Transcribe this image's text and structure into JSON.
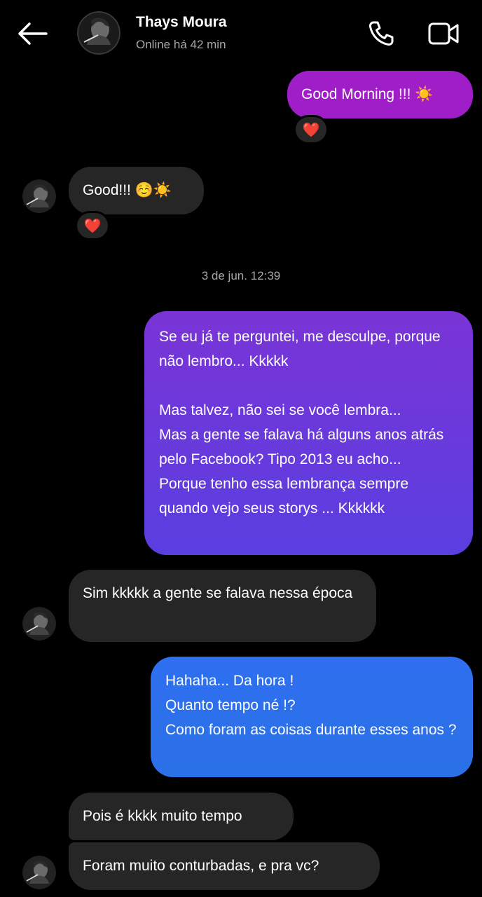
{
  "header": {
    "contact_name": "Thays Moura",
    "status": "Online há 42 min",
    "back_icon": "arrow-left-icon",
    "call_icon": "phone-icon",
    "video_icon": "video-camera-icon"
  },
  "timestamp": "3 de jun. 12:39",
  "messages": [
    {
      "side": "sent",
      "text": "Good Morning !!! ☀️",
      "reaction": "❤️"
    },
    {
      "side": "received",
      "text": "Good!!! ☺️☀️",
      "reaction": "❤️"
    },
    {
      "side": "sent",
      "text": "Se eu já te perguntei, me desculpe, porque não lembro... Kkkkk\n\nMas talvez, não sei se você lembra...\nMas a gente se falava há alguns anos atrás pelo Facebook? Tipo 2013 eu acho...\nPorque tenho essa lembrança sempre quando vejo seus storys ... Kkkkkk"
    },
    {
      "side": "received",
      "text": "Sim kkkkk a gente se falava nessa época"
    },
    {
      "side": "sent",
      "text": "Hahaha... Da hora !\nQuanto tempo né !?\nComo foram as coisas durante esses anos ?"
    },
    {
      "side": "received",
      "text": "Pois é kkkk muito tempo"
    },
    {
      "side": "received",
      "text": "Foram muito conturbadas, e pra vc?"
    }
  ],
  "colors": {
    "background": "#000000",
    "sent_purple": "#a01ec8",
    "sent_violet": "#6a38dc",
    "sent_blue": "#2c70ec",
    "received": "#262626",
    "reaction_heart": "#e8303f"
  }
}
